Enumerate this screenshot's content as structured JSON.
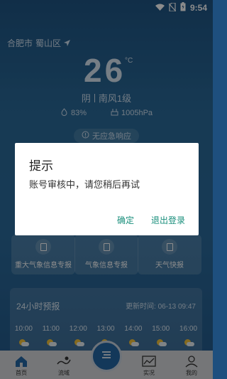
{
  "status_bar": {
    "time": "9:54"
  },
  "location": {
    "city": "合肥市",
    "district": "蜀山区"
  },
  "current": {
    "temperature": "26",
    "unit": "°C",
    "condition": "阴",
    "wind": "南风1级",
    "humidity": "83%",
    "pressure": "1005hPa"
  },
  "alert": {
    "label": "无应急响应"
  },
  "info_cards": [
    {
      "label": "重大气象信息专报"
    },
    {
      "label": "气象信息专报"
    },
    {
      "label": "天气快报"
    }
  ],
  "forecast": {
    "title": "24小时预报",
    "updated": "更新时间: 06-13 09:47",
    "hours": [
      "10:00",
      "11:00",
      "12:00",
      "13:00",
      "14:00",
      "15:00",
      "16:00"
    ]
  },
  "dialog": {
    "title": "提示",
    "message": "账号审核中，请您稍后再试",
    "confirm": "确定",
    "logout": "退出登录"
  },
  "tabbar": {
    "home": "首页",
    "basin": "流域",
    "live": "实况",
    "mine": "我的"
  },
  "colors": {
    "accent": "#1a8f7c",
    "tab_accent": "#2466a5"
  }
}
